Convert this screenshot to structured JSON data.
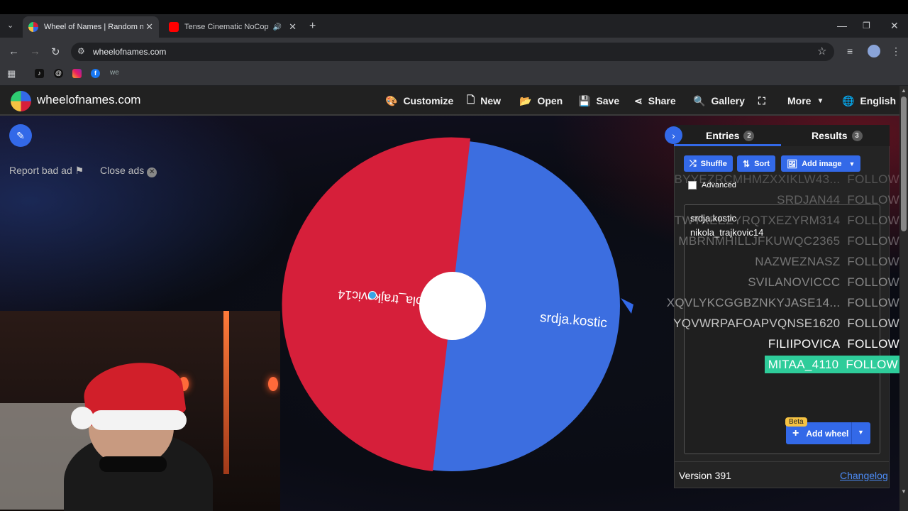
{
  "browser": {
    "tabs": [
      {
        "title": "Wheel of Names | Random nan",
        "active": true
      },
      {
        "title": "Tense Cinematic NoCopyrig",
        "active": false
      }
    ],
    "url": "wheelofnames.com",
    "window_controls": [
      "minimize",
      "restore",
      "close"
    ]
  },
  "header": {
    "site_name": "wheelofnames.com",
    "menu": [
      {
        "label": "Customize",
        "icon": "palette-icon"
      },
      {
        "label": "New",
        "icon": "file-icon"
      },
      {
        "label": "Open",
        "icon": "folder-icon"
      },
      {
        "label": "Save",
        "icon": "save-icon"
      },
      {
        "label": "Share",
        "icon": "share-icon"
      },
      {
        "label": "Gallery",
        "icon": "search-icon"
      },
      {
        "label": "",
        "icon": "fullscreen-icon"
      },
      {
        "label": "More",
        "icon": "caret-down-icon"
      },
      {
        "label": "English",
        "icon": "globe-icon"
      }
    ]
  },
  "ads": {
    "report_label": "Report bad ad",
    "close_label": "Close ads"
  },
  "wheel": {
    "segments": [
      {
        "label": "nikola_trajkovic14",
        "color": "#d61f3a"
      },
      {
        "label": "srdja.kostic",
        "color": "#3c6ee0"
      }
    ]
  },
  "panel": {
    "tabs": [
      {
        "label": "Entries",
        "count": "2"
      },
      {
        "label": "Results",
        "count": "3"
      }
    ],
    "buttons": {
      "shuffle": "Shuffle",
      "sort": "Sort",
      "add_image": "Add image"
    },
    "advanced_label": "Advanced",
    "entries": [
      "srdja.kostic",
      "nikola_trajkovic14"
    ],
    "add_wheel_label": "Add wheel",
    "beta_label": "Beta",
    "version": "Version 391",
    "changelog": "Changelog"
  },
  "chat_overlay": [
    {
      "user": "BYYEZRCMHMZXXIKLW43...",
      "action": "FOLLOW"
    },
    {
      "user": "SRDJAN44",
      "action": "FOLLOW"
    },
    {
      "user": "TWTXEEZYRQTXEZYRM314",
      "action": "FOLLOW"
    },
    {
      "user": "MBRNMHILLJFKUWQC2365",
      "action": "FOLLOW"
    },
    {
      "user": "NAZWEZNASZ",
      "action": "FOLLOW"
    },
    {
      "user": "SVILANOVICCC",
      "action": "FOLLOW"
    },
    {
      "user": "XQVLYKCGGBZNKYJASE14...",
      "action": "FOLLOW"
    },
    {
      "user": "YQVWRPAFOAPVQNSE1620",
      "action": "FOLLOW"
    },
    {
      "user": "FILIIPOVICA",
      "action": "FOLLOW"
    },
    {
      "user": "MITAA_4110",
      "action": "FOLLOW"
    }
  ],
  "colors": {
    "accent": "#3369e8",
    "red_segment": "#d61f3a",
    "blue_segment": "#3c6ee0",
    "highlight": "#2ecc9a"
  }
}
